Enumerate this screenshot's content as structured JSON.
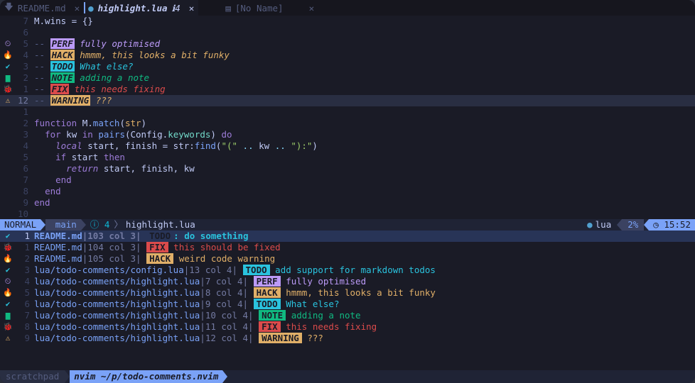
{
  "colors": {
    "bg": "#1a1b26",
    "perf": "#bb9af7",
    "hack": "#e0af68",
    "todo": "#2ac3de",
    "note": "#10b981",
    "fix": "#db4b4b",
    "warning": "#e0af68",
    "accent": "#7aa2f7"
  },
  "tabs": [
    {
      "icon": "🡇",
      "name": "README.md",
      "close": "✕",
      "active": false
    },
    {
      "icon": "●",
      "name": "highlight.lua",
      "modified": "ℹ4",
      "close": "✕",
      "active": true
    },
    {
      "icon": "▤",
      "name": "[No Name]",
      "close": "✕",
      "active": false
    }
  ],
  "editor": {
    "lines": [
      {
        "num": "7",
        "sign": "",
        "code": "M.wins = {}"
      },
      {
        "num": "6",
        "sign": "",
        "code": ""
      },
      {
        "num": "5",
        "sign": "perf-icon",
        "comment": "-- ",
        "tag": "PERF",
        "tag_key": "perf",
        "msg": "fully optimised"
      },
      {
        "num": "4",
        "sign": "hack-icon",
        "comment": "-- ",
        "tag": "HACK",
        "tag_key": "hack",
        "msg": "hmmm, this looks a bit funky"
      },
      {
        "num": "3",
        "sign": "todo-icon",
        "comment": "-- ",
        "tag": "TODO",
        "tag_key": "todo",
        "msg": "What else?"
      },
      {
        "num": "2",
        "sign": "note-icon",
        "comment": "-- ",
        "tag": "NOTE",
        "tag_key": "note",
        "msg": "adding a note"
      },
      {
        "num": "1",
        "sign": "fix-icon",
        "comment": "-- ",
        "tag": "FIX",
        "tag_key": "fix",
        "msg": "this needs fixing"
      },
      {
        "num": "12",
        "sign": "warning-icon",
        "comment": "-- ",
        "tag": "WARNING",
        "tag_key": "warn",
        "msg": "???",
        "current": true
      },
      {
        "num": "1",
        "sign": "",
        "code": ""
      },
      {
        "num": "2",
        "sign": "",
        "code": "function M.match(str)"
      },
      {
        "num": "3",
        "sign": "",
        "code": "  for kw in pairs(Config.keywords) do"
      },
      {
        "num": "4",
        "sign": "",
        "code": "    local start, finish = str:find(\"(\" .. kw .. \"):\")"
      },
      {
        "num": "5",
        "sign": "",
        "code": "    if start then"
      },
      {
        "num": "6",
        "sign": "",
        "code": "      return start, finish, kw"
      },
      {
        "num": "7",
        "sign": "",
        "code": "    end"
      },
      {
        "num": "8",
        "sign": "",
        "code": "  end"
      },
      {
        "num": "9",
        "sign": "",
        "code": "end"
      },
      {
        "num": "10",
        "sign": "",
        "code": ""
      }
    ]
  },
  "statusline": {
    "mode": "NORMAL",
    "branch_icon": "",
    "branch": "main",
    "diag_icon": "ⓘ",
    "diag_count": "4",
    "separator": "〉",
    "filename": "highlight.lua",
    "lang_icon": "●",
    "lang": "lua",
    "percent": "2%",
    "clock_icon": "◷",
    "time": "15:52"
  },
  "quickfix": [
    {
      "num": "1",
      "sign": "todo-icon",
      "sign_key": "todo",
      "file": "README.md",
      "pos": "103 col 3",
      "tag": "TODO",
      "tag_key": "todo",
      "msg": ": do something",
      "selected": true
    },
    {
      "num": "1",
      "sign": "fix-icon",
      "sign_key": "fix",
      "file": "README.md",
      "pos": "104 col 3",
      "tag": "FIX",
      "tag_key": "fix",
      "msg": " this should be fixed"
    },
    {
      "num": "2",
      "sign": "hack-icon",
      "sign_key": "hack",
      "file": "README.md",
      "pos": "105 col 3",
      "tag": "HACK",
      "tag_key": "hack",
      "msg": " weird code warning"
    },
    {
      "num": "3",
      "sign": "todo-icon",
      "sign_key": "todo",
      "file": "lua/todo-comments/config.lua",
      "pos": "13 col 4",
      "tag": "TODO",
      "tag_key": "todo",
      "msg": " add support for markdown todos"
    },
    {
      "num": "4",
      "sign": "perf-icon",
      "sign_key": "perf",
      "file": "lua/todo-comments/highlight.lua",
      "pos": "7 col 4",
      "tag": "PERF",
      "tag_key": "perf",
      "msg": " fully optimised"
    },
    {
      "num": "5",
      "sign": "hack-icon",
      "sign_key": "hack",
      "file": "lua/todo-comments/highlight.lua",
      "pos": "8 col 4",
      "tag": "HACK",
      "tag_key": "hack",
      "msg": " hmmm, this looks a bit funky"
    },
    {
      "num": "6",
      "sign": "todo-icon",
      "sign_key": "todo",
      "file": "lua/todo-comments/highlight.lua",
      "pos": "9 col 4",
      "tag": "TODO",
      "tag_key": "todo",
      "msg": " What else?"
    },
    {
      "num": "7",
      "sign": "note-icon",
      "sign_key": "note",
      "file": "lua/todo-comments/highlight.lua",
      "pos": "10 col 4",
      "tag": "NOTE",
      "tag_key": "note",
      "msg": " adding a note"
    },
    {
      "num": "8",
      "sign": "fix-icon",
      "sign_key": "fix",
      "file": "lua/todo-comments/highlight.lua",
      "pos": "11 col 4",
      "tag": "FIX",
      "tag_key": "fix",
      "msg": " this needs fixing"
    },
    {
      "num": "9",
      "sign": "warning-icon",
      "sign_key": "warn",
      "file": "lua/todo-comments/highlight.lua",
      "pos": "12 col 4",
      "tag": "WARNING",
      "tag_key": "warn",
      "msg": " ???"
    }
  ],
  "tmux": {
    "window_inactive": "scratchpad",
    "window_active": "nvim ~/p/todo-comments.nvim"
  },
  "sign_glyphs": {
    "perf-icon": "⏲",
    "hack-icon": "🔥",
    "todo-icon": "✔",
    "note-icon": "▆",
    "fix-icon": "🐞",
    "warning-icon": "⚠"
  }
}
